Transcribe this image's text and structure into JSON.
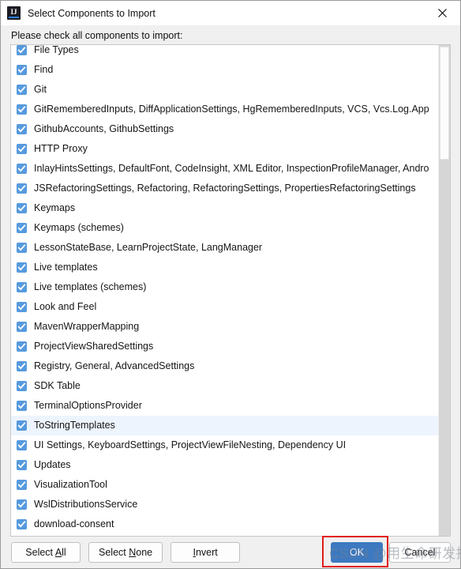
{
  "window": {
    "title": "Select Components to Import",
    "app_icon": "intellij-idea-icon",
    "close_icon": "close-icon"
  },
  "prompt": "Please check all components to import:",
  "list": {
    "items": [
      {
        "label": "File Types",
        "checked": true,
        "selected": false
      },
      {
        "label": "Find",
        "checked": true,
        "selected": false
      },
      {
        "label": "Git",
        "checked": true,
        "selected": false
      },
      {
        "label": "GitRememberedInputs, DiffApplicationSettings, HgRememberedInputs, VCS, Vcs.Log.App",
        "checked": true,
        "selected": false
      },
      {
        "label": "GithubAccounts, GithubSettings",
        "checked": true,
        "selected": false
      },
      {
        "label": "HTTP Proxy",
        "checked": true,
        "selected": false
      },
      {
        "label": "InlayHintsSettings, DefaultFont, CodeInsight, XML Editor, InspectionProfileManager, Andro",
        "checked": true,
        "selected": false
      },
      {
        "label": "JSRefactoringSettings, Refactoring, RefactoringSettings, PropertiesRefactoringSettings",
        "checked": true,
        "selected": false
      },
      {
        "label": "Keymaps",
        "checked": true,
        "selected": false
      },
      {
        "label": "Keymaps (schemes)",
        "checked": true,
        "selected": false
      },
      {
        "label": "LessonStateBase, LearnProjectState, LangManager",
        "checked": true,
        "selected": false
      },
      {
        "label": "Live templates",
        "checked": true,
        "selected": false
      },
      {
        "label": "Live templates (schemes)",
        "checked": true,
        "selected": false
      },
      {
        "label": "Look and Feel",
        "checked": true,
        "selected": false
      },
      {
        "label": "MavenWrapperMapping",
        "checked": true,
        "selected": false
      },
      {
        "label": "ProjectViewSharedSettings",
        "checked": true,
        "selected": false
      },
      {
        "label": "Registry, General, AdvancedSettings",
        "checked": true,
        "selected": false
      },
      {
        "label": "SDK Table",
        "checked": true,
        "selected": false
      },
      {
        "label": "TerminalOptionsProvider",
        "checked": true,
        "selected": false
      },
      {
        "label": "ToStringTemplates",
        "checked": true,
        "selected": true
      },
      {
        "label": "UI Settings, KeyboardSettings, ProjectViewFileNesting, Dependency UI",
        "checked": true,
        "selected": false
      },
      {
        "label": "Updates",
        "checked": true,
        "selected": false
      },
      {
        "label": "VisualizationTool",
        "checked": true,
        "selected": false
      },
      {
        "label": "WslDistributionsService",
        "checked": true,
        "selected": false
      },
      {
        "label": "download-consent",
        "checked": true,
        "selected": false
      }
    ]
  },
  "buttons": {
    "select_all": {
      "text": "Select All",
      "mnemonic": "A"
    },
    "select_none": {
      "text": "Select None",
      "mnemonic": "N"
    },
    "invert": {
      "text": "Invert",
      "mnemonic": "I"
    },
    "ok": "OK",
    "cancel": "Cancel"
  },
  "annotation": {
    "color": "#e21b1b",
    "target": "ok-button"
  },
  "watermark": {
    "text": "CSDN @用生命研发技术"
  }
}
